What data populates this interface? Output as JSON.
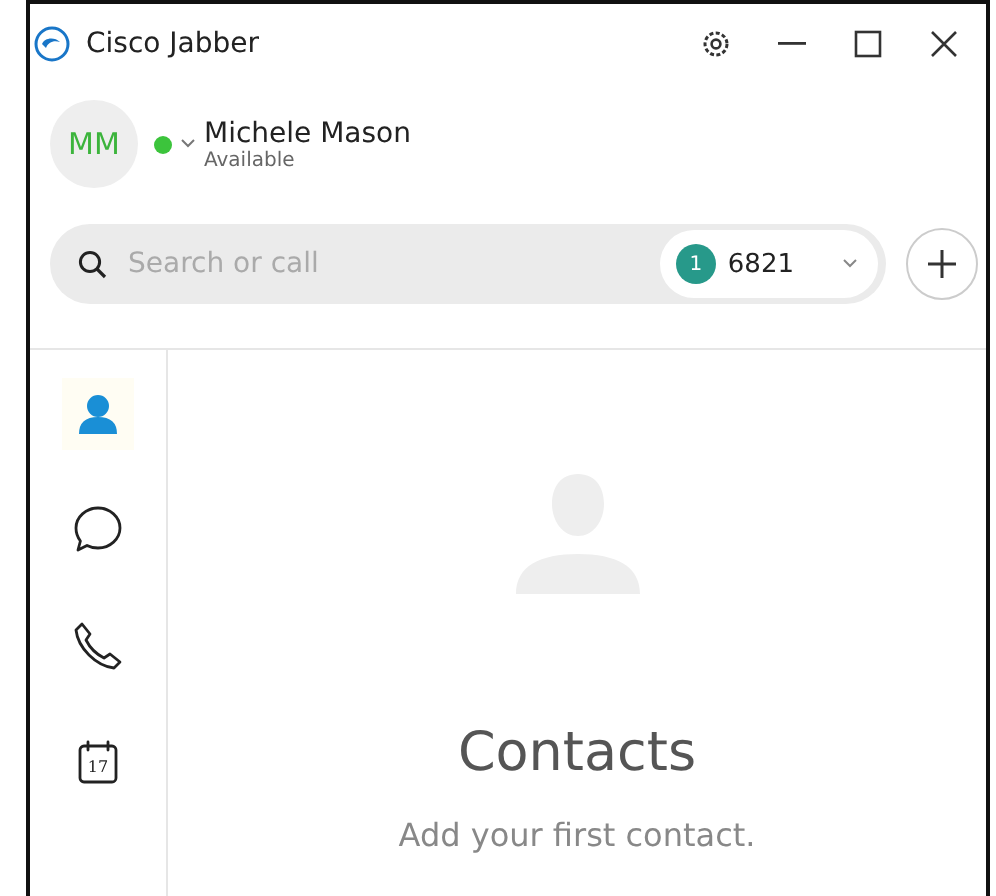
{
  "window": {
    "title": "Cisco Jabber"
  },
  "user": {
    "initials": "MM",
    "name": "Michele Mason",
    "status": "Available",
    "online": true
  },
  "search": {
    "placeholder": "Search or call",
    "line_badge": "1",
    "line_number": "6821"
  },
  "sidebar": {
    "items": [
      {
        "kind": "contacts",
        "selected": true
      },
      {
        "kind": "chat",
        "selected": false
      },
      {
        "kind": "calls",
        "selected": false
      },
      {
        "kind": "calendar",
        "selected": false,
        "day": "17"
      }
    ]
  },
  "empty_state": {
    "title": "Contacts",
    "message": "Add your first contact."
  }
}
